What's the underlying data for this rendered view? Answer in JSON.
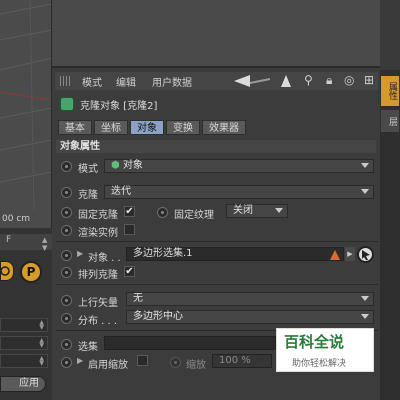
{
  "viewport": {
    "unit_readout": "00 cm"
  },
  "timeline": {
    "frame_label": "F"
  },
  "left_panel": {
    "p_button": "P",
    "apply_label": "应用"
  },
  "menu": {
    "items": [
      "模式",
      "编辑",
      "用户数据"
    ]
  },
  "object": {
    "title": "克隆对象 [克隆2]"
  },
  "tabs": [
    "基本",
    "坐标",
    "对象",
    "变换",
    "效果器"
  ],
  "active_tab": "对象",
  "section": {
    "title": "对象属性"
  },
  "fields": {
    "mode_label": "模式",
    "mode_value": "对象",
    "clones_label": "克隆",
    "clones_value": "迭代",
    "fixed_clone_label": "固定克隆",
    "fixed_texture_label": "固定纹理",
    "fixed_texture_value": "关闭",
    "render_instances_label": "渲染实例",
    "object_label": "对象 . .",
    "object_value": "多边形选集.1",
    "arrange_clone_label": "排列克隆",
    "up_vector_label": "上行矢量",
    "up_vector_value": "无",
    "distribution_label": "分布 . . .",
    "distribution_value": "多边形中心",
    "selection_label": "选集",
    "enable_scale_label": "启用缩放",
    "scale_label": "缩放",
    "scale_value": "100 %"
  },
  "side_tabs": [
    "属性",
    "层"
  ],
  "watermark": {
    "brand": "百科全说",
    "slogan": "助你轻松解决"
  },
  "colors": {
    "accent_orange": "#d79b2b",
    "active_tab": "#8aa3c4",
    "brand_green": "#2c7a3c"
  }
}
